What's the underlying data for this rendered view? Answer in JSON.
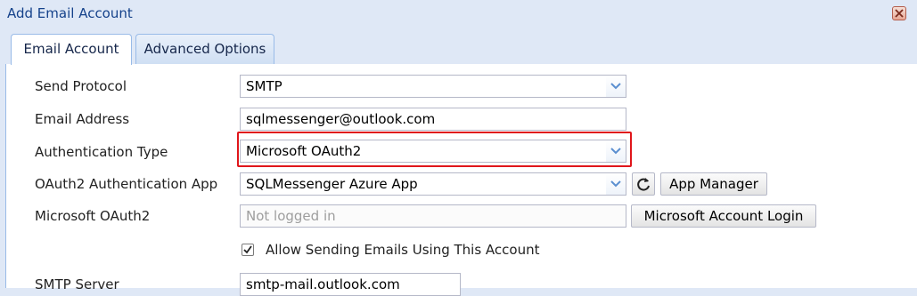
{
  "window": {
    "title": "Add Email Account"
  },
  "tabs": [
    {
      "label": "Email Account",
      "active": true
    },
    {
      "label": "Advanced Options",
      "active": false
    }
  ],
  "form": {
    "send_protocol": {
      "label": "Send Protocol",
      "value": "SMTP"
    },
    "email_address": {
      "label": "Email Address",
      "value": "sqlmessenger@outlook.com"
    },
    "auth_type": {
      "label": "Authentication Type",
      "value": "Microsoft OAuth2"
    },
    "oauth_app": {
      "label": "OAuth2 Authentication App",
      "value": "SQLMessenger Azure App",
      "button": "App Manager"
    },
    "ms_oauth": {
      "label": "Microsoft OAuth2",
      "placeholder": "Not logged in",
      "button": "Microsoft Account Login"
    },
    "allow_sending": {
      "label": "Allow Sending Emails Using This Account",
      "checked": true
    },
    "smtp_server": {
      "label": "SMTP Server",
      "value": "smtp-mail.outlook.com"
    }
  },
  "icons": {
    "close": "close-icon",
    "dropdown": "chevron-down-icon",
    "refresh": "refresh-icon",
    "check": "checkmark-icon"
  },
  "colors": {
    "highlight": "#e0161b",
    "title": "#15428b",
    "border": "#99bbe8"
  }
}
